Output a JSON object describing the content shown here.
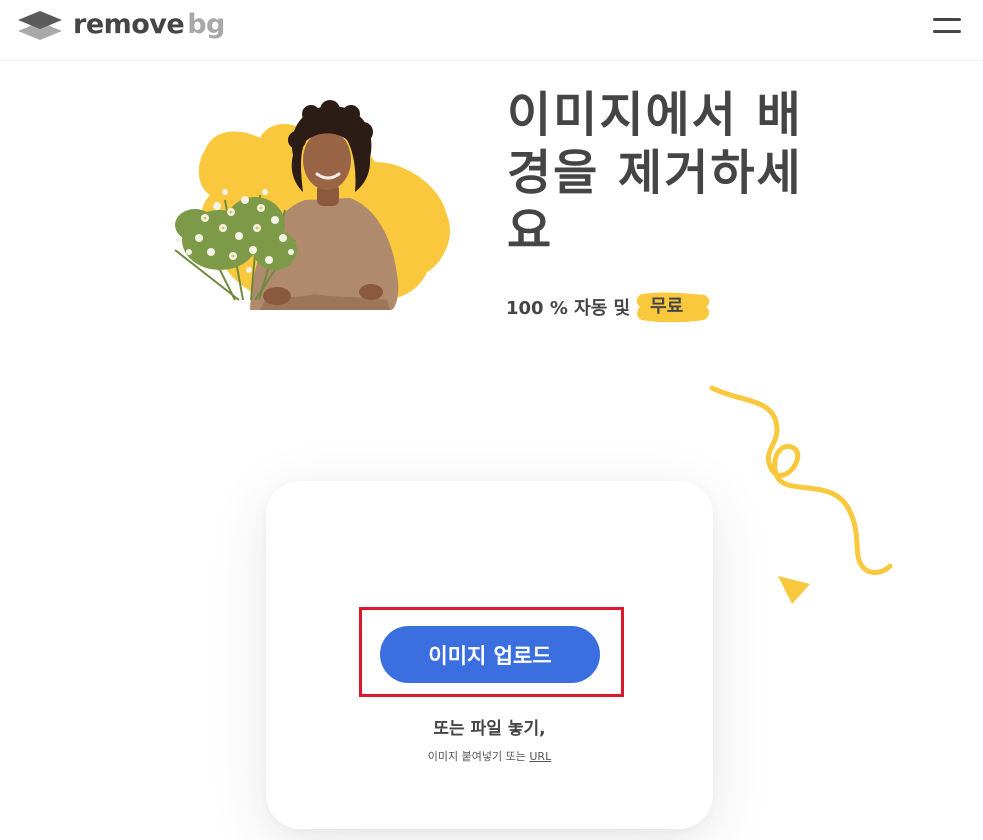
{
  "header": {
    "logo_word": "remove",
    "logo_suffix": "bg",
    "menu_icon": "hamburger-menu-icon"
  },
  "hero": {
    "title": "이미지에서 배경을 제거하세요",
    "subtitle_prefix": "100 % 자동 및",
    "subtitle_badge": "무료",
    "image_icon": "woman-with-flowers-photo"
  },
  "upload": {
    "button_label": "이미지 업로드",
    "drop_text": "또는 파일 놓기,",
    "paste_text": "이미지 붙여넣기 또는",
    "url_link": "URL"
  },
  "colors": {
    "accent_blue": "#3b6fe0",
    "accent_yellow": "#f9c83c",
    "text_dark": "#454545",
    "logo_gray": "#a8a8a8",
    "highlight_red": "#e0162b"
  }
}
